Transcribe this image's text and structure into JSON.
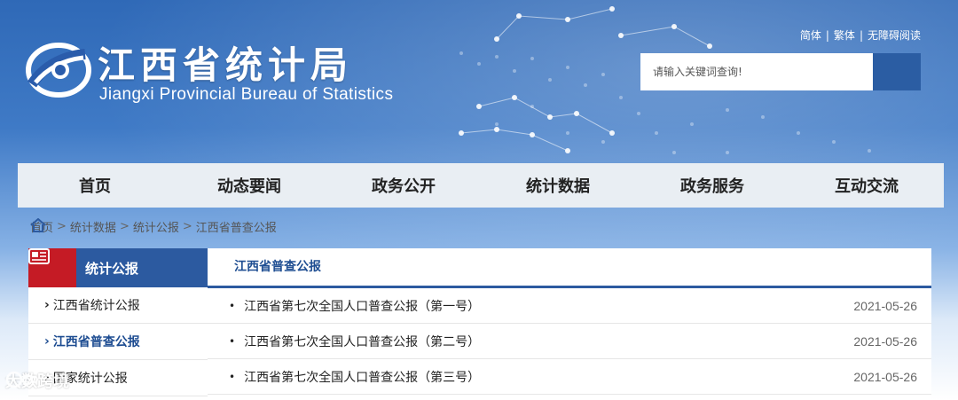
{
  "header": {
    "title": "江西省统计局",
    "subtitle": "Jiangxi Provincial Bureau of Statistics",
    "lang_options": [
      "简体",
      "繁体",
      "无障碍阅读"
    ],
    "search_placeholder": "请输入关键词查询!"
  },
  "nav": {
    "items": [
      "首页",
      "动态要闻",
      "政务公开",
      "统计数据",
      "政务服务",
      "互动交流"
    ]
  },
  "breadcrumb": {
    "items": [
      "首页",
      "统计数据",
      "统计公报",
      "江西省普查公报"
    ]
  },
  "sidebar": {
    "title": "统计公报",
    "items": [
      {
        "label": "江西省统计公报",
        "active": false
      },
      {
        "label": "江西省普查公报",
        "active": true
      },
      {
        "label": "国家统计公报",
        "active": false
      }
    ]
  },
  "content": {
    "section_title": "江西省普查公报",
    "rows": [
      {
        "title": "江西省第七次全国人口普查公报（第一号）",
        "date": "2021-05-26"
      },
      {
        "title": "江西省第七次全国人口普查公报（第二号）",
        "date": "2021-05-26"
      },
      {
        "title": "江西省第七次全国人口普查公报（第三号）",
        "date": "2021-05-26"
      }
    ]
  },
  "watermark": {
    "text": "大数跨境"
  },
  "colors": {
    "brand_blue": "#2c5aa0",
    "accent_red": "#c51b25",
    "nav_bg": "#e9eef3"
  }
}
